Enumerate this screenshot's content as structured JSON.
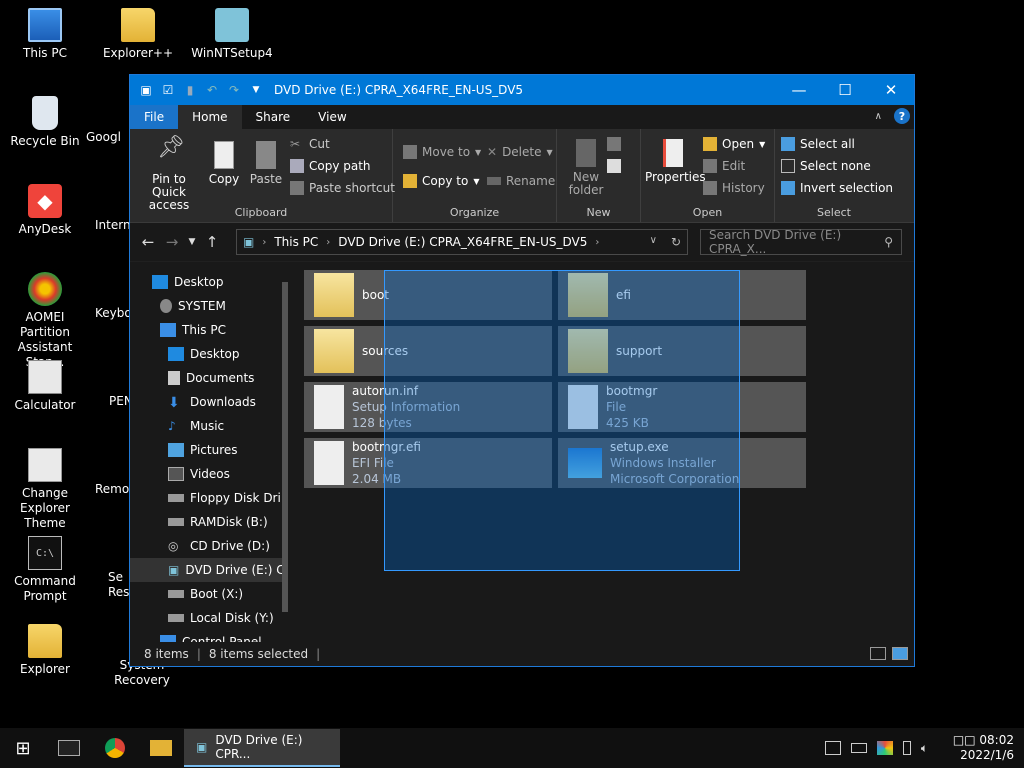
{
  "desktop": {
    "icons": [
      {
        "label": "This PC"
      },
      {
        "label": "Explorer++"
      },
      {
        "label": "WinNTSetup4"
      },
      {
        "label": "Recycle Bin"
      },
      {
        "label": "Googl"
      },
      {
        "label": "AnyDesk"
      },
      {
        "label": "Interne"
      },
      {
        "label": "AOMEI Partition Assistant Stan..."
      },
      {
        "label": "Keybo"
      },
      {
        "label": "Calculator"
      },
      {
        "label": "PEN"
      },
      {
        "label": "Change Explorer Theme"
      },
      {
        "label": "Remot"
      },
      {
        "label": "Command Prompt"
      },
      {
        "label": "Se Res"
      },
      {
        "label": "Explorer"
      },
      {
        "label": "System Recovery"
      }
    ]
  },
  "window": {
    "title": "DVD Drive (E:) CPRA_X64FRE_EN-US_DV5",
    "menu": {
      "file": "File",
      "home": "Home",
      "share": "Share",
      "view": "View"
    },
    "ribbon": {
      "clipboard": {
        "label": "Clipboard",
        "pin": "Pin to Quick access",
        "copy": "Copy",
        "paste": "Paste",
        "cut": "Cut",
        "copy_path": "Copy path",
        "paste_shortcut": "Paste shortcut"
      },
      "organize": {
        "label": "Organize",
        "move_to": "Move to",
        "copy_to": "Copy to",
        "delete": "Delete",
        "rename": "Rename"
      },
      "new": {
        "label": "New",
        "new_folder": "New folder"
      },
      "open": {
        "label": "Open",
        "properties": "Properties",
        "open": "Open",
        "edit": "Edit",
        "history": "History"
      },
      "select": {
        "label": "Select",
        "select_all": "Select all",
        "select_none": "Select none",
        "invert": "Invert selection"
      }
    },
    "address": {
      "this_pc": "This PC",
      "drive": "DVD Drive (E:) CPRA_X64FRE_EN-US_DV5",
      "search_placeholder": "Search DVD Drive (E:) CPRA_X..."
    },
    "nav": [
      {
        "label": "Desktop"
      },
      {
        "label": "SYSTEM"
      },
      {
        "label": "This PC"
      },
      {
        "label": "Desktop"
      },
      {
        "label": "Documents"
      },
      {
        "label": "Downloads"
      },
      {
        "label": "Music"
      },
      {
        "label": "Pictures"
      },
      {
        "label": "Videos"
      },
      {
        "label": "Floppy Disk Dri"
      },
      {
        "label": "RAMDisk (B:)"
      },
      {
        "label": "CD Drive (D:)"
      },
      {
        "label": "DVD Drive (E:) C"
      },
      {
        "label": "Boot (X:)"
      },
      {
        "label": "Local Disk (Y:)"
      },
      {
        "label": "Control Panel"
      }
    ],
    "files": [
      {
        "name": "boot",
        "line2": "",
        "line3": ""
      },
      {
        "name": "efi",
        "line2": "",
        "line3": ""
      },
      {
        "name": "sources",
        "line2": "",
        "line3": ""
      },
      {
        "name": "support",
        "line2": "",
        "line3": ""
      },
      {
        "name": "autorun.inf",
        "line2": "Setup Information",
        "line3": "128 bytes"
      },
      {
        "name": "bootmgr",
        "line2": "File",
        "line3": "425 KB"
      },
      {
        "name": "bootmgr.efi",
        "line2": "EFI File",
        "line3": "2.04 MB"
      },
      {
        "name": "setup.exe",
        "line2": "Windows Installer",
        "line3": "Microsoft Corporation"
      }
    ],
    "status": {
      "count": "8 items",
      "selected": "8 items selected"
    }
  },
  "taskbar": {
    "task_label": "DVD Drive (E:) CPR...",
    "time": "08:02",
    "date": "2022/1/6",
    "lang": "□□"
  },
  "colors": {
    "accent": "#0078d7",
    "window_bg": "#202020",
    "tile_bg": "#555555",
    "selection": "#3399ff"
  }
}
